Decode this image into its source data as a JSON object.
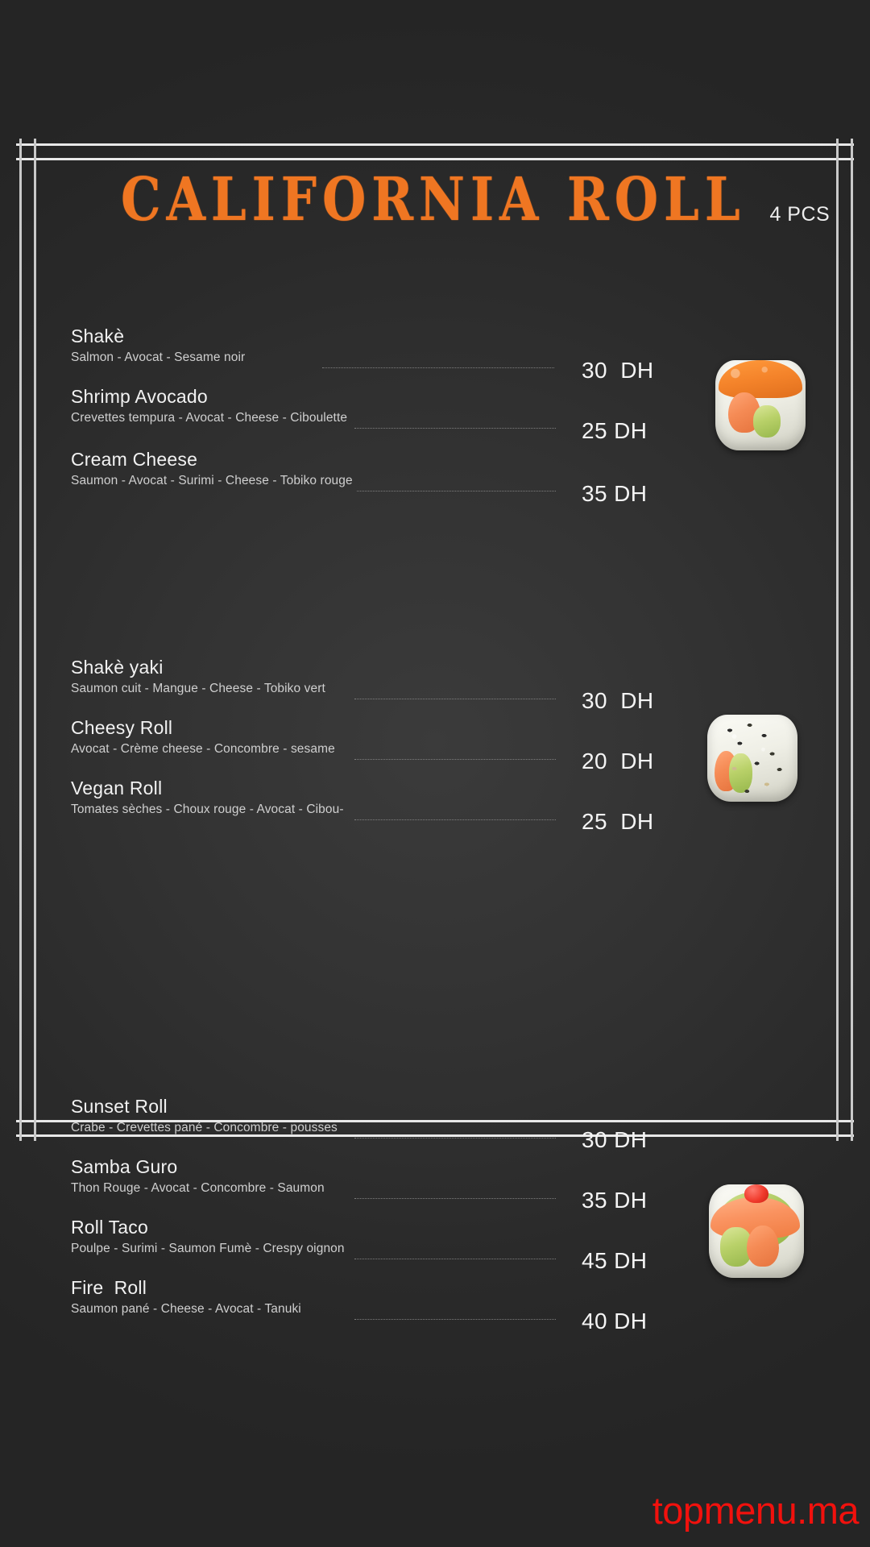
{
  "menu": {
    "title": "CALIFORNIA ROLL",
    "pieces_badge": "4 PCS",
    "currency": "DH",
    "accent_color": "#ef7622",
    "background_color": "#2c2c2c",
    "text_color": "#f2f2f2",
    "watermark": "topmenu.ma",
    "watermark_color": "#f1110d",
    "sections": [
      {
        "id": "section-1",
        "photo": "sushi-roll-orange-tobiko",
        "items": [
          {
            "name": "Shakè",
            "description": "Salmon - Avocat - Sesame noir",
            "price": "30  DH"
          },
          {
            "name": "Shrimp Avocado",
            "description": "Crevettes tempura - Avocat - Cheese - Ciboulette",
            "price": "25 DH"
          },
          {
            "name": "Cream Cheese",
            "description": "Saumon - Avocat - Surimi - Cheese - Tobiko rouge",
            "price": "35 DH"
          }
        ]
      },
      {
        "id": "section-2",
        "photo": "sushi-roll-sesame",
        "items": [
          {
            "name": "Shakè yaki",
            "description": "Saumon cuit - Mangue - Cheese - Tobiko vert",
            "price": "30  DH"
          },
          {
            "name": "Cheesy Roll",
            "description": "Avocat - Crème cheese - Concombre - sesame",
            "price": "20  DH"
          },
          {
            "name": "Vegan Roll",
            "description": "Tomates sèches - Choux rouge - Avocat - Cibou-",
            "price": "25  DH"
          }
        ]
      },
      {
        "id": "section-3",
        "photo": "sushi-roll-salmon-top",
        "items": [
          {
            "name": "Sunset Roll",
            "description": "Crabe - Crevettes pané - Concombre - pousses",
            "price": "30 DH"
          },
          {
            "name": "Samba Guro",
            "description": "Thon Rouge - Avocat - Concombre - Saumon",
            "price": "35 DH"
          },
          {
            "name": "Roll Taco",
            "description": "Poulpe - Surimi - Saumon Fumè - Crespy oignon",
            "price": "45 DH"
          },
          {
            "name": "Fire  Roll",
            "description": "Saumon pané - Cheese - Avocat - Tanuki",
            "price": "40 DH"
          }
        ]
      }
    ]
  }
}
